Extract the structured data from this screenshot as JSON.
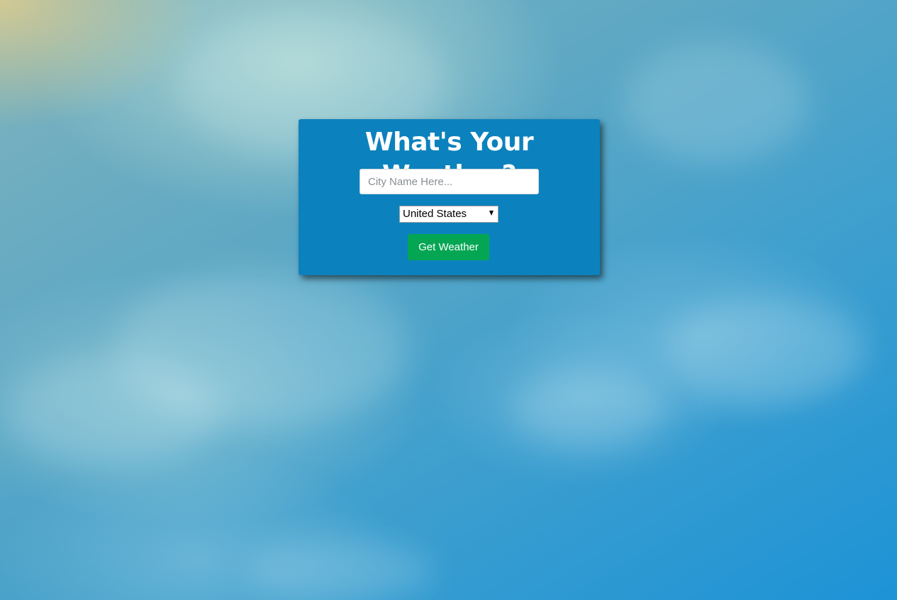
{
  "form": {
    "title": "What's Your Weather?",
    "city_placeholder": "City Name Here...",
    "city_value": "",
    "country_selected": "United States",
    "submit_label": "Get Weather"
  },
  "colors": {
    "card_background": "#0b82bd",
    "button_background": "#04a654",
    "title_text": "#ffffff"
  },
  "icons": {
    "dropdown": "chevron-down-icon"
  }
}
